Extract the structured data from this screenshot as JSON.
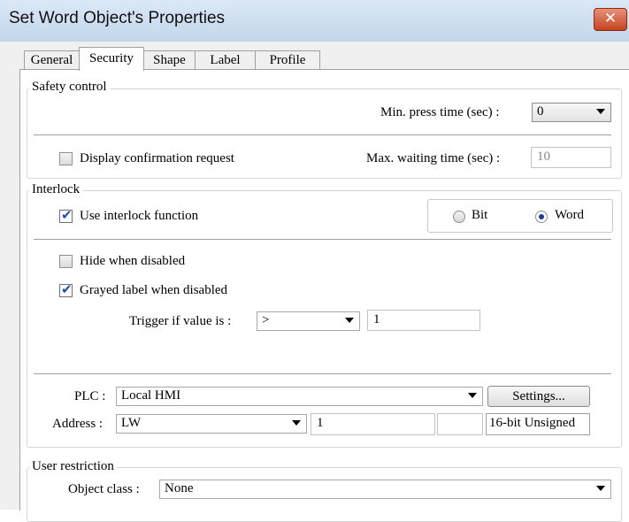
{
  "window": {
    "title": "Set Word Object's Properties"
  },
  "tabs": [
    {
      "label": "General"
    },
    {
      "label": "Security"
    },
    {
      "label": "Shape"
    },
    {
      "label": "Label"
    },
    {
      "label": "Profile"
    }
  ],
  "safety_control": {
    "title": "Safety control",
    "min_press_label": "Min. press time (sec) :",
    "min_press_value": "0",
    "display_confirmation_label": "Display confirmation request",
    "display_confirmation_checked": false,
    "max_waiting_label": "Max. waiting time (sec) :",
    "max_waiting_value": "10"
  },
  "interlock": {
    "title": "Interlock",
    "use_interlock_label": "Use interlock function",
    "use_interlock_checked": true,
    "radio_bit_label": "Bit",
    "radio_word_label": "Word",
    "selected_radio": "Word",
    "hide_disabled_label": "Hide when disabled",
    "hide_disabled_checked": false,
    "grayed_label_label": "Grayed label when disabled",
    "grayed_label_checked": true,
    "trigger_label": "Trigger if value is :",
    "trigger_operator": ">",
    "trigger_value": "1",
    "plc_label": "PLC :",
    "plc_value": "Local HMI",
    "settings_label": "Settings...",
    "address_label": "Address :",
    "address_device": "LW",
    "address_value": "1",
    "data_type": "16-bit Unsigned"
  },
  "user_restriction": {
    "title": "User restriction",
    "object_class_label": "Object class :",
    "object_class_value": "None"
  }
}
